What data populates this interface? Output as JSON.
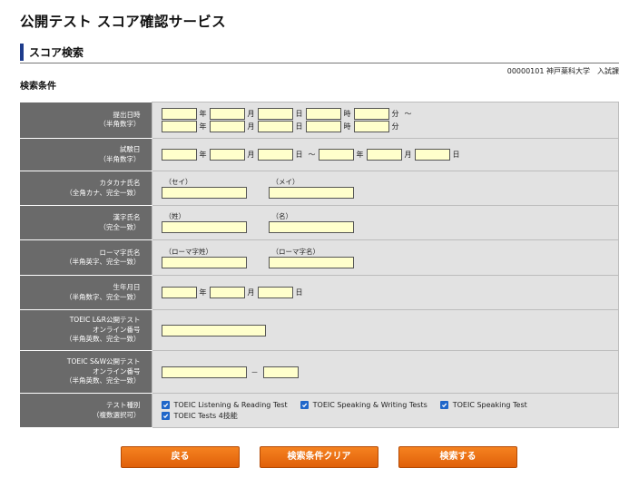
{
  "app": {
    "title": "公開テスト スコア確認サービス"
  },
  "section": {
    "title": "スコア検索"
  },
  "user_info": "00000101 神戸薬科大学　入試課",
  "conditions_label": "検索条件",
  "rows": {
    "submit_datetime": {
      "label": "提出日時",
      "sub": "（半角数字）",
      "units": [
        "年",
        "月",
        "日",
        "時",
        "分"
      ],
      "tilde": "～"
    },
    "exam_date": {
      "label": "試験日",
      "sub": "（半角数字）",
      "units": [
        "年",
        "月",
        "日"
      ],
      "tilde": "～"
    },
    "katakana_name": {
      "label": "カタカナ氏名",
      "sub": "（全角カナ、完全一致）",
      "first": "（セイ）",
      "second": "（メイ）"
    },
    "kanji_name": {
      "label": "漢字氏名",
      "sub": "（完全一致）",
      "first": "（姓）",
      "second": "（名）"
    },
    "roman_name": {
      "label": "ローマ字氏名",
      "sub": "（半角英字、完全一致）",
      "first": "（ローマ字姓）",
      "second": "（ローマ字名）"
    },
    "birthdate": {
      "label": "生年月日",
      "sub": "（半角数字、完全一致）",
      "units": [
        "年",
        "月",
        "日"
      ]
    },
    "lr_number": {
      "label1": "TOEIC L&R公開テスト",
      "label2": "オンライン番号",
      "sub": "（半角英数、完全一致）"
    },
    "sw_number": {
      "label1": "TOEIC S&W公開テスト",
      "label2": "オンライン番号",
      "sub": "（半角英数、完全一致）",
      "dash": "－"
    },
    "test_type": {
      "label": "テスト種別",
      "sub": "（複数選択可）",
      "options": [
        {
          "label": "TOEIC Listening & Reading Test",
          "checked": true
        },
        {
          "label": "TOEIC Speaking & Writing Tests",
          "checked": true
        },
        {
          "label": "TOEIC Speaking Test",
          "checked": true
        },
        {
          "label": "TOEIC Tests 4技能",
          "checked": true
        }
      ]
    }
  },
  "buttons": {
    "back": "戻る",
    "clear": "検索条件クリア",
    "search": "検索する"
  },
  "colors": {
    "accent_bar": "#1e3c8c",
    "label_bg": "#6a6a6a",
    "field_bg": "#e2e2e2",
    "input_bg": "#ffffcc",
    "button": "#f07418",
    "checkbox": "#1f66c9"
  }
}
